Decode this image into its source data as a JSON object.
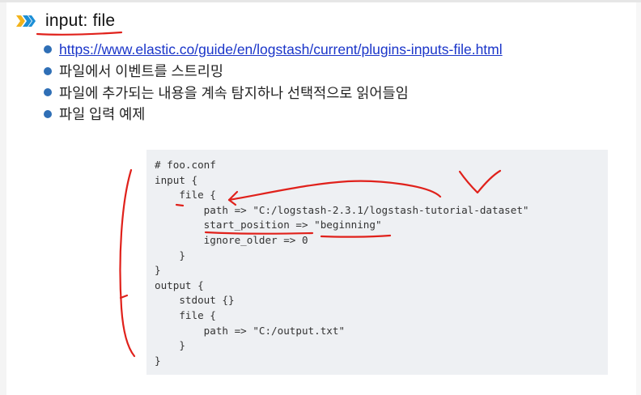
{
  "slide": {
    "title": "input: file",
    "bullets": [
      {
        "text": "https://www.elastic.co/guide/en/logstash/current/plugins-inputs-file.html",
        "is_link": true
      },
      {
        "text": "파일에서 이벤트를 스트리밍",
        "is_link": false
      },
      {
        "text": "파일에 추가되는 내용을 계속 탐지하나 선택적으로 읽어들임",
        "is_link": false
      },
      {
        "text": "파일 입력 예제",
        "is_link": false
      }
    ],
    "code_lines": [
      "# foo.conf",
      "input {",
      "    file {",
      "        path => \"C:/logstash-2.3.1/logstash-tutorial-dataset\"",
      "        start_position => \"beginning\"",
      "        ignore_older => 0",
      "    }",
      "}",
      "output {",
      "    stdout {}",
      "    file {",
      "        path => \"C:/output.txt\"",
      "    }",
      "}"
    ]
  },
  "colors": {
    "title_underline": "#e0211b",
    "bullet": "#2f6fb6",
    "link": "#1a35c9",
    "annotation": "#e0211b",
    "code_bg": "#eef0f3",
    "chevron": "#1d8fd6"
  },
  "icons": [
    "chevrons-icon",
    "bullet-dot-icon"
  ]
}
